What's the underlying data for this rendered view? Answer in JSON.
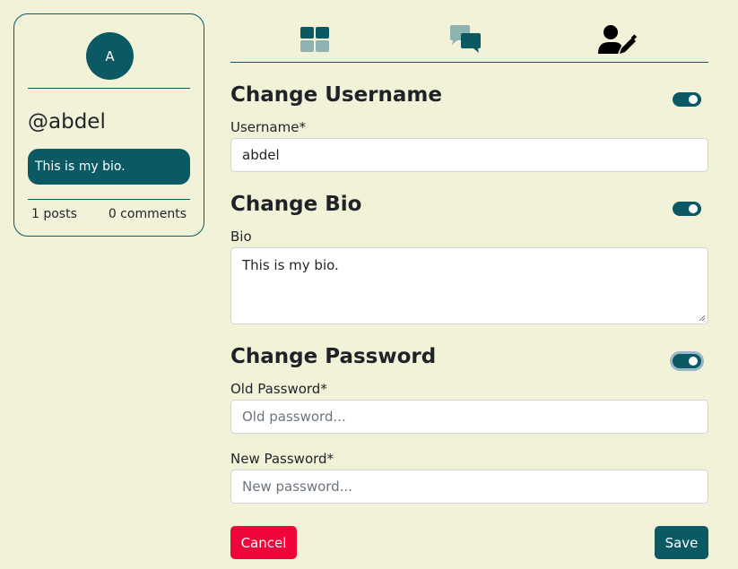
{
  "profile": {
    "avatar_initial": "A",
    "handle": "@abdel",
    "bio": "This is my bio.",
    "posts": "1 posts",
    "comments": "0 comments"
  },
  "tabs": [
    {
      "icon": "dashboard-icon"
    },
    {
      "icon": "chat-icon"
    },
    {
      "icon": "user-edit-icon"
    }
  ],
  "form": {
    "username_section": {
      "title": "Change Username",
      "label": "Username*",
      "value": "abdel",
      "toggle_on": true
    },
    "bio_section": {
      "title": "Change Bio",
      "label": "Bio",
      "value": "This is my bio.",
      "toggle_on": true
    },
    "password_section": {
      "title": "Change Password",
      "old_label": "Old Password*",
      "old_placeholder": "Old password...",
      "new_label": "New Password*",
      "new_placeholder": "New password...",
      "toggle_on": true
    },
    "cancel_label": "Cancel",
    "save_label": "Save"
  },
  "colors": {
    "primary": "#0b5a63",
    "danger": "#f0053a",
    "background": "#f1f2d8"
  }
}
